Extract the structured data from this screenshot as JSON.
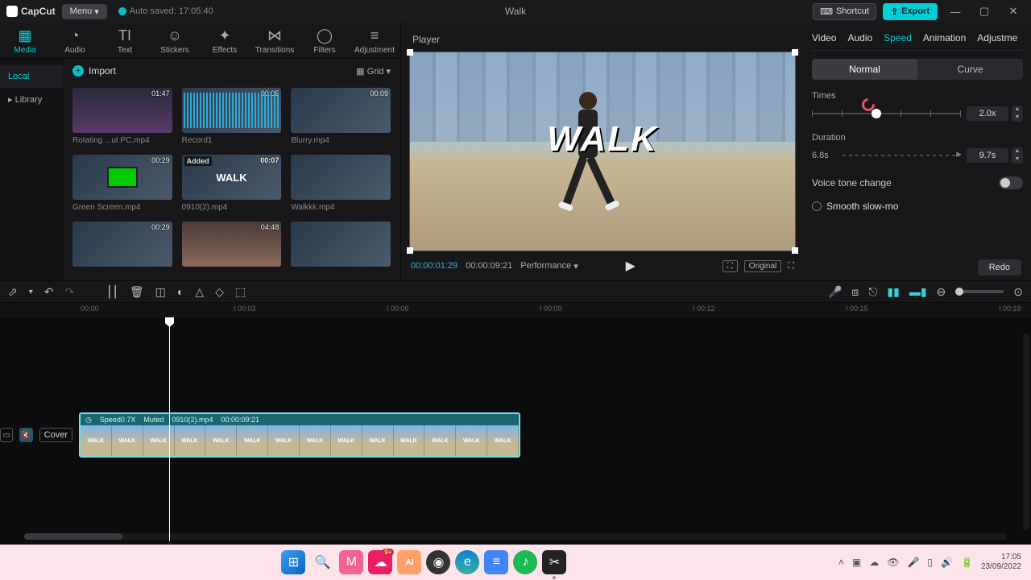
{
  "titlebar": {
    "app_name": "CapCut",
    "menu_label": "Menu",
    "autosave_text": "Auto saved: 17:05:40",
    "project_title": "Walk",
    "shortcut_label": "Shortcut",
    "export_label": "Export"
  },
  "top_tabs": [
    {
      "label": "Media",
      "icon": "▦"
    },
    {
      "label": "Audio",
      "icon": "◔"
    },
    {
      "label": "Text",
      "icon": "TI"
    },
    {
      "label": "Stickers",
      "icon": "☺"
    },
    {
      "label": "Effects",
      "icon": "✦"
    },
    {
      "label": "Transitions",
      "icon": "⋈"
    },
    {
      "label": "Filters",
      "icon": "◯"
    },
    {
      "label": "Adjustment",
      "icon": "≡"
    }
  ],
  "media_side": {
    "local": "Local",
    "library": "Library"
  },
  "media_main": {
    "import_label": "Import",
    "view_label": "Grid ▾"
  },
  "clips": [
    {
      "name": "Rotating ...ut PC.mp4",
      "duration": "01:47"
    },
    {
      "name": "Record1",
      "duration": "00:05"
    },
    {
      "name": "Blurry.mp4",
      "duration": "00:09"
    },
    {
      "name": "Green Screen.mp4",
      "duration": "00:29"
    },
    {
      "name": "0910(2).mp4",
      "duration": "00:07",
      "added": "Added"
    },
    {
      "name": "Walkkk.mp4",
      "duration": ""
    },
    {
      "name": "",
      "duration": "00:29"
    },
    {
      "name": "",
      "duration": "04:48"
    },
    {
      "name": "",
      "duration": ""
    }
  ],
  "player": {
    "header": "Player",
    "overlay_text": "WALK",
    "tc_current": "00:00:01:29",
    "tc_total": "00:00:09:21",
    "performance_label": "Performance",
    "original_label": "Original"
  },
  "inspect": {
    "tabs": [
      "Video",
      "Audio",
      "Speed",
      "Animation",
      "Adjustme"
    ],
    "active_tab": 2,
    "mode_normal": "Normal",
    "mode_curve": "Curve",
    "times_label": "Times",
    "times_value": "2.0x",
    "duration_label": "Duration",
    "duration_left": "6.8s",
    "duration_value": "9.7s",
    "voice_label": "Voice tone change",
    "smooth_label": "Smooth slow-mo",
    "redo_label": "Redo"
  },
  "timeline": {
    "ruler": [
      "00:00",
      "I 00:03",
      "I 00:06",
      "I 00:09",
      "I 00:12",
      "I 00:15",
      "I 00:18"
    ],
    "cover_label": "Cover",
    "clip": {
      "speed_label": "Speed0.7X",
      "muted_label": "Muted",
      "name_label": "0910(2).mp4",
      "dur_label": "00:00:09:21",
      "thumb_text": "WALK"
    }
  },
  "taskbar": {
    "badge": "9+",
    "ai": "AI",
    "time": "17:05",
    "date": "23/09/2022"
  }
}
